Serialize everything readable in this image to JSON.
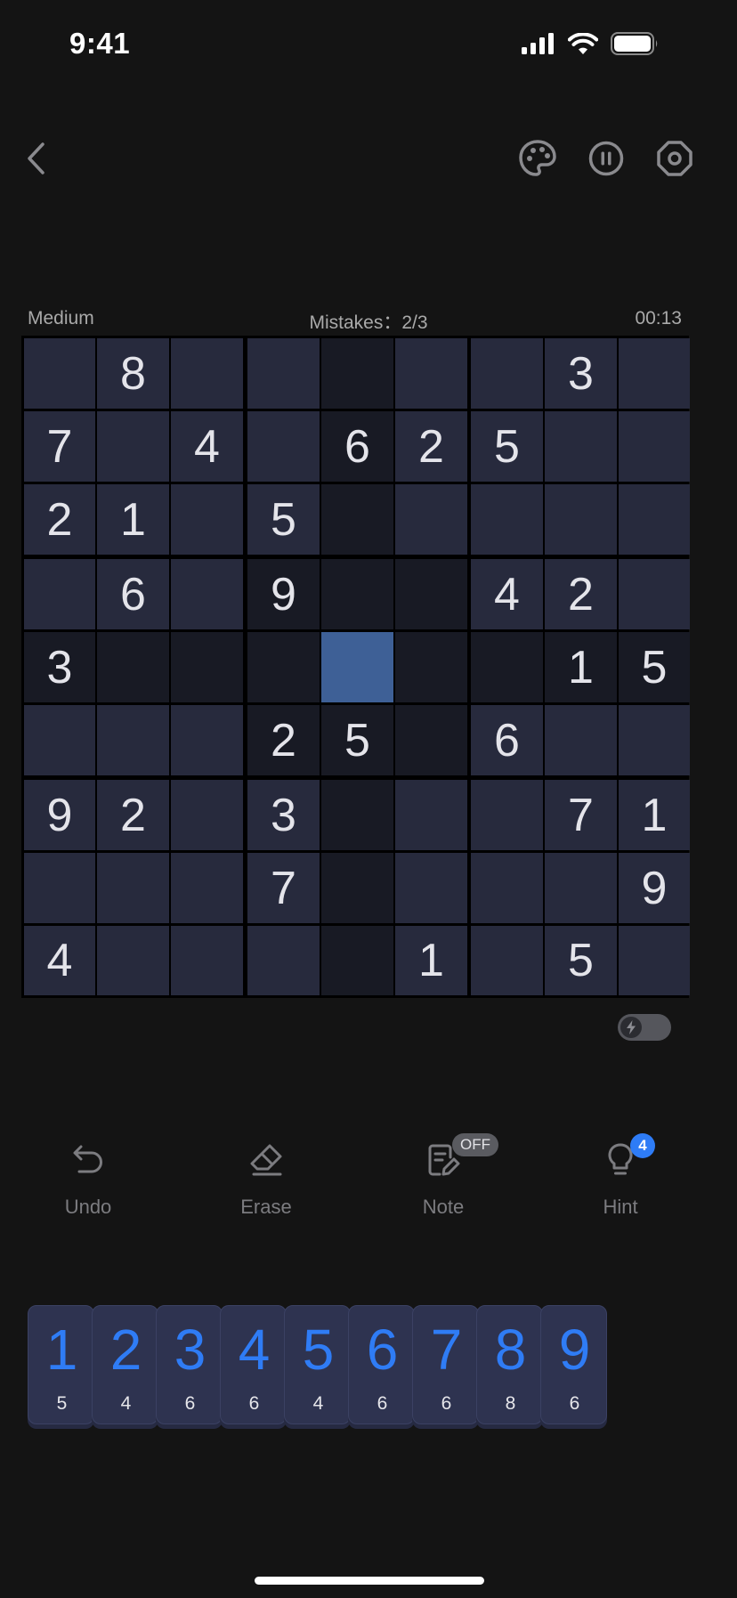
{
  "status": {
    "time": "9:41"
  },
  "header": {
    "back_label": "",
    "icons": [
      "chevron-left-icon",
      "palette-icon",
      "pause-icon",
      "settings-icon"
    ]
  },
  "game": {
    "difficulty": "Medium",
    "mistakes": "Mistakes：2/3",
    "timer": "00:13",
    "selected": [
      4,
      4
    ],
    "grid": [
      [
        "",
        "8",
        "",
        "",
        "",
        "",
        "",
        "3",
        ""
      ],
      [
        "7",
        "",
        "4",
        "",
        "6",
        "2",
        "5",
        "",
        ""
      ],
      [
        "2",
        "1",
        "",
        "5",
        "",
        "",
        "",
        "",
        ""
      ],
      [
        "",
        "6",
        "",
        "9",
        "",
        "",
        "4",
        "2",
        ""
      ],
      [
        "3",
        "",
        "",
        "",
        "",
        "",
        "",
        "1",
        "5"
      ],
      [
        "",
        "",
        "",
        "2",
        "5",
        "",
        "6",
        "",
        ""
      ],
      [
        "9",
        "2",
        "",
        "3",
        "",
        "",
        "",
        "7",
        "1"
      ],
      [
        "",
        "",
        "",
        "7",
        "",
        "",
        "",
        "",
        "9"
      ],
      [
        "4",
        "",
        "",
        "",
        "",
        "1",
        "",
        "5",
        ""
      ]
    ],
    "colors": {
      "cell": "#272a3d",
      "cell_highlight": "#181a24",
      "cell_selected": "#3e6096",
      "digit": "#e4e4ea",
      "accent": "#2f7cf5"
    },
    "quick_toggle_on": false
  },
  "toolbar": {
    "undo": "Undo",
    "erase": "Erase",
    "note": "Note",
    "note_badge": "OFF",
    "hint": "Hint",
    "hint_badge": "4"
  },
  "numpad": {
    "keys": [
      {
        "digit": "1",
        "remaining": "5"
      },
      {
        "digit": "2",
        "remaining": "4"
      },
      {
        "digit": "3",
        "remaining": "6"
      },
      {
        "digit": "4",
        "remaining": "6"
      },
      {
        "digit": "5",
        "remaining": "4"
      },
      {
        "digit": "6",
        "remaining": "6"
      },
      {
        "digit": "7",
        "remaining": "6"
      },
      {
        "digit": "8",
        "remaining": "8"
      },
      {
        "digit": "9",
        "remaining": "6"
      }
    ]
  }
}
